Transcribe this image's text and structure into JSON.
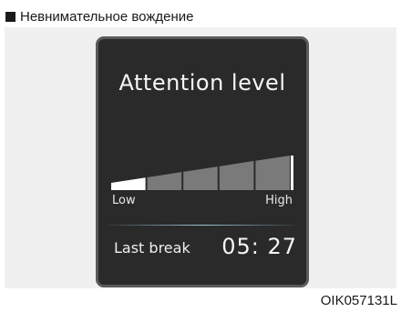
{
  "heading": "Невнимательное вождение",
  "display": {
    "title": "Attention level",
    "level": {
      "segments": 5,
      "filled_segments": 1,
      "low_label": "Low",
      "high_label": "High"
    },
    "last_break_label": "Last break",
    "last_break_time": "05: 27"
  },
  "figure_code": "OIK057131L",
  "colors": {
    "screen_background": "#2a2a2a",
    "filled_segment": "#ffffff",
    "empty_segment": "#7a7a7a",
    "divider_accent": "#9cc7d6"
  }
}
